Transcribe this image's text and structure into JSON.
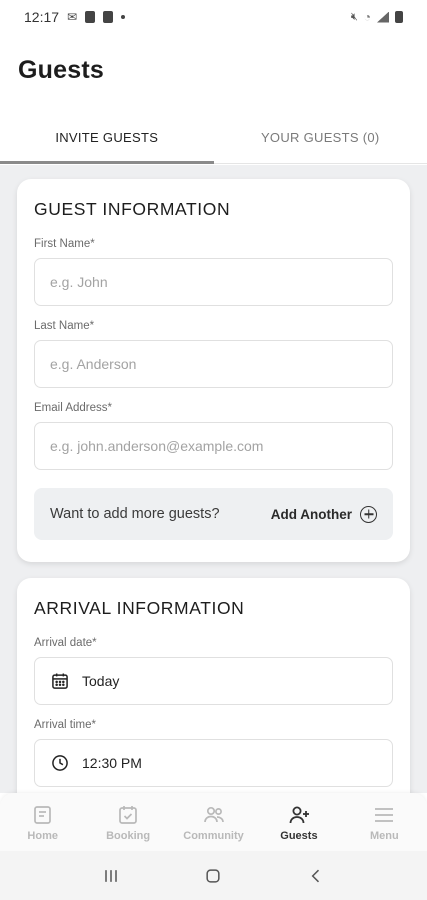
{
  "status_bar": {
    "time": "12:17"
  },
  "header": {
    "title": "Guests"
  },
  "tabs": [
    {
      "label": "INVITE GUESTS",
      "active": true
    },
    {
      "label": "YOUR GUESTS (0)",
      "active": false
    }
  ],
  "guest_info": {
    "title": "GUEST INFORMATION",
    "first_name": {
      "label": "First Name*",
      "placeholder": "e.g. John"
    },
    "last_name": {
      "label": "Last Name*",
      "placeholder": "e.g. Anderson"
    },
    "email": {
      "label": "Email Address*",
      "placeholder": "e.g. john.anderson@example.com"
    },
    "add_more": {
      "prompt": "Want to add more guests?",
      "action": "Add Another"
    }
  },
  "arrival_info": {
    "title": "ARRIVAL INFORMATION",
    "date": {
      "label": "Arrival date*",
      "value": "Today",
      "icon": "calendar-icon"
    },
    "time": {
      "label": "Arrival time*",
      "value": "12:30 PM",
      "icon": "clock-icon"
    }
  },
  "bottom_nav": [
    {
      "label": "Home",
      "icon": "home-icon",
      "active": false
    },
    {
      "label": "Booking",
      "icon": "booking-icon",
      "active": false
    },
    {
      "label": "Community",
      "icon": "community-icon",
      "active": false
    },
    {
      "label": "Guests",
      "icon": "add-person-icon",
      "active": true
    },
    {
      "label": "Menu",
      "icon": "menu-icon",
      "active": false
    }
  ],
  "colors": {
    "content_bg": "#eeeff1",
    "active_tab_indicator": "#8a8a8a",
    "inactive_nav": "#b9b9b9"
  }
}
